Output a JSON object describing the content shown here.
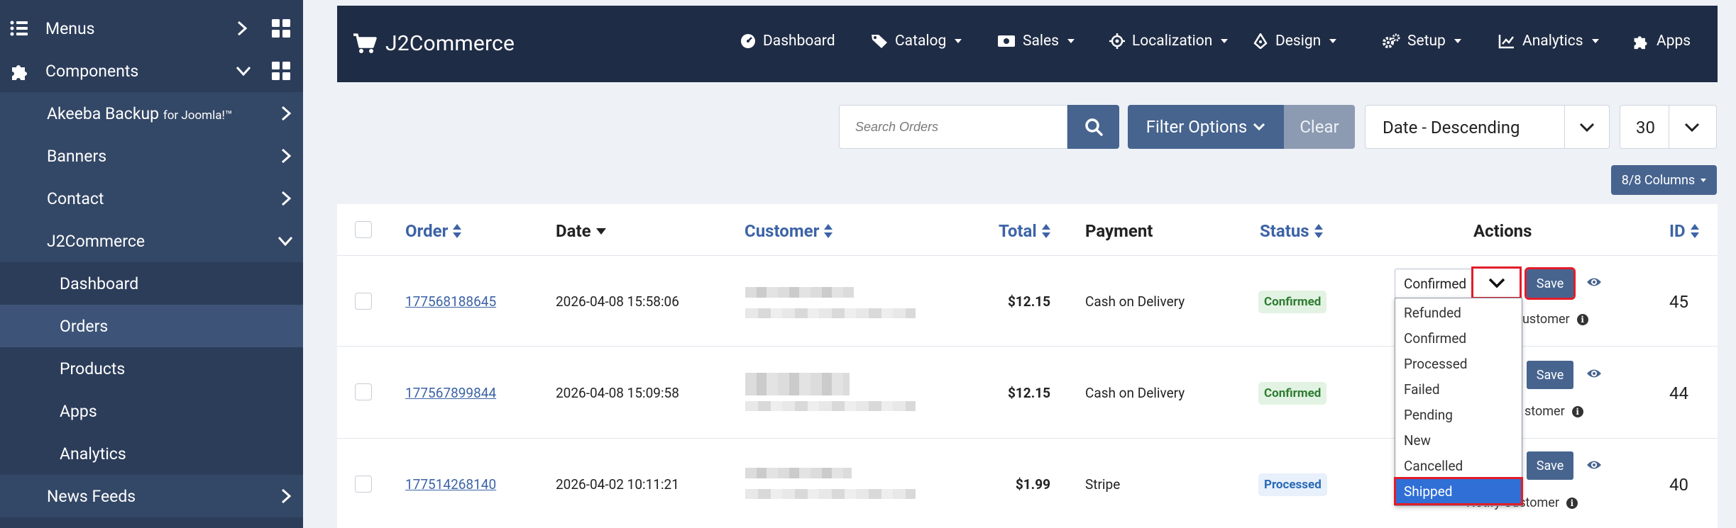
{
  "sidebar": {
    "items": [
      {
        "label": "Menus",
        "icon": "list-icon"
      },
      {
        "label": "Components",
        "icon": "puzzle-icon"
      },
      {
        "label": "Akeeba Backup",
        "suffix": "for Joomla!™"
      },
      {
        "label": "Banners"
      },
      {
        "label": "Contact"
      },
      {
        "label": "J2Commerce"
      },
      {
        "label": "Dashboard"
      },
      {
        "label": "Orders"
      },
      {
        "label": "Products"
      },
      {
        "label": "Apps"
      },
      {
        "label": "Analytics"
      },
      {
        "label": "News Feeds"
      }
    ]
  },
  "header": {
    "brand": "J2Commerce",
    "nav": [
      {
        "label": "Dashboard",
        "icon": "gauge-icon"
      },
      {
        "label": "Catalog",
        "icon": "tag-icon"
      },
      {
        "label": "Sales",
        "icon": "money-icon"
      },
      {
        "label": "Localization",
        "icon": "crosshair-icon"
      },
      {
        "label": "Design",
        "icon": "pen-icon"
      },
      {
        "label": "Setup",
        "icon": "cogs-icon"
      },
      {
        "label": "Analytics",
        "icon": "chart-line-icon"
      },
      {
        "label": "Apps",
        "icon": "puzzle-icon"
      }
    ]
  },
  "toolbar": {
    "search_placeholder": "Search Orders",
    "filter_label": "Filter Options",
    "clear_label": "Clear",
    "sort_value": "Date - Descending",
    "limit_value": "30",
    "columns_label": "8/8 Columns"
  },
  "table": {
    "headers": {
      "order": "Order",
      "date": "Date",
      "customer": "Customer",
      "total": "Total",
      "payment": "Payment",
      "status": "Status",
      "actions": "Actions",
      "id": "ID"
    },
    "rows": [
      {
        "order": "177568188645",
        "date": "2026-04-08 15:58:06",
        "total": "$12.15",
        "payment": "Cash on Delivery",
        "status": "Confirmed",
        "id": "45"
      },
      {
        "order": "177567899844",
        "date": "2026-04-08 15:09:58",
        "total": "$12.15",
        "payment": "Cash on Delivery",
        "status": "Confirmed",
        "id": "44"
      },
      {
        "order": "177514268140",
        "date": "2026-04-02 10:11:21",
        "total": "$1.99",
        "payment": "Stripe",
        "status": "Processed",
        "id": "40"
      }
    ],
    "actions": {
      "select_value": "Confirmed",
      "save_label": "Save",
      "notify_label_partial": "ustomer",
      "notify_label_full": "Notify Customer",
      "notify_label_partial2": "stomer"
    }
  },
  "status_dropdown": {
    "options": [
      "Refunded",
      "Confirmed",
      "Processed",
      "Failed",
      "Pending",
      "New",
      "Cancelled",
      "Shipped"
    ],
    "selected": "Shipped"
  },
  "colors": {
    "sidebar_bg": "#2c3d5a",
    "header_bg": "#1f2c45",
    "primary": "#47648f",
    "link": "#3c63a6",
    "highlight": "#e11d2a"
  }
}
